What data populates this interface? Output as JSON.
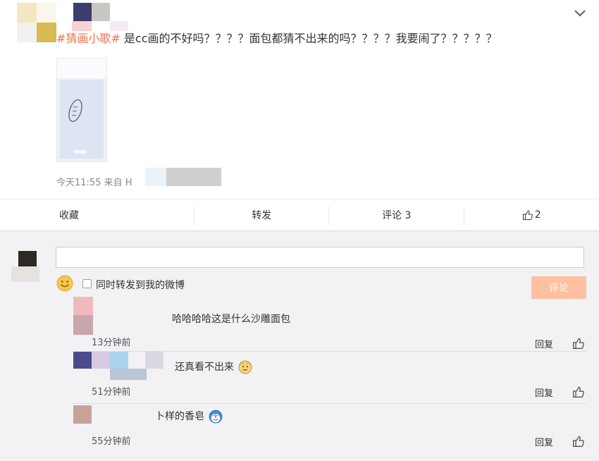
{
  "post": {
    "topic": "#猜画小歌#",
    "text": " 是cc画的不好吗？？？？面包都猜不出来的吗？？？？我要闹了？？？？？",
    "meta": "今天11:55 来自 H"
  },
  "actions": {
    "favorite": "收藏",
    "repost": "转发",
    "comment": "评论 3",
    "like_count": "2"
  },
  "composer": {
    "placeholder": "",
    "repost_label": "同时转发到我的微博",
    "submit_label": "评论"
  },
  "comments": [
    {
      "text": "哈哈哈哈这是什么沙雕面包",
      "time": "13分钟前",
      "reply": "回复",
      "emoji": ""
    },
    {
      "text": "还真看不出来",
      "time": "51分钟前",
      "reply": "回复",
      "emoji": "doge-face-icon"
    },
    {
      "text": "卜样的香皂",
      "time": "55分钟前",
      "reply": "回复",
      "emoji": "doraemon-face-icon"
    }
  ],
  "colors": {
    "topic": "#eb7350",
    "submit_button": "#ffc09f",
    "comment_bg": "#f2f2f5"
  }
}
